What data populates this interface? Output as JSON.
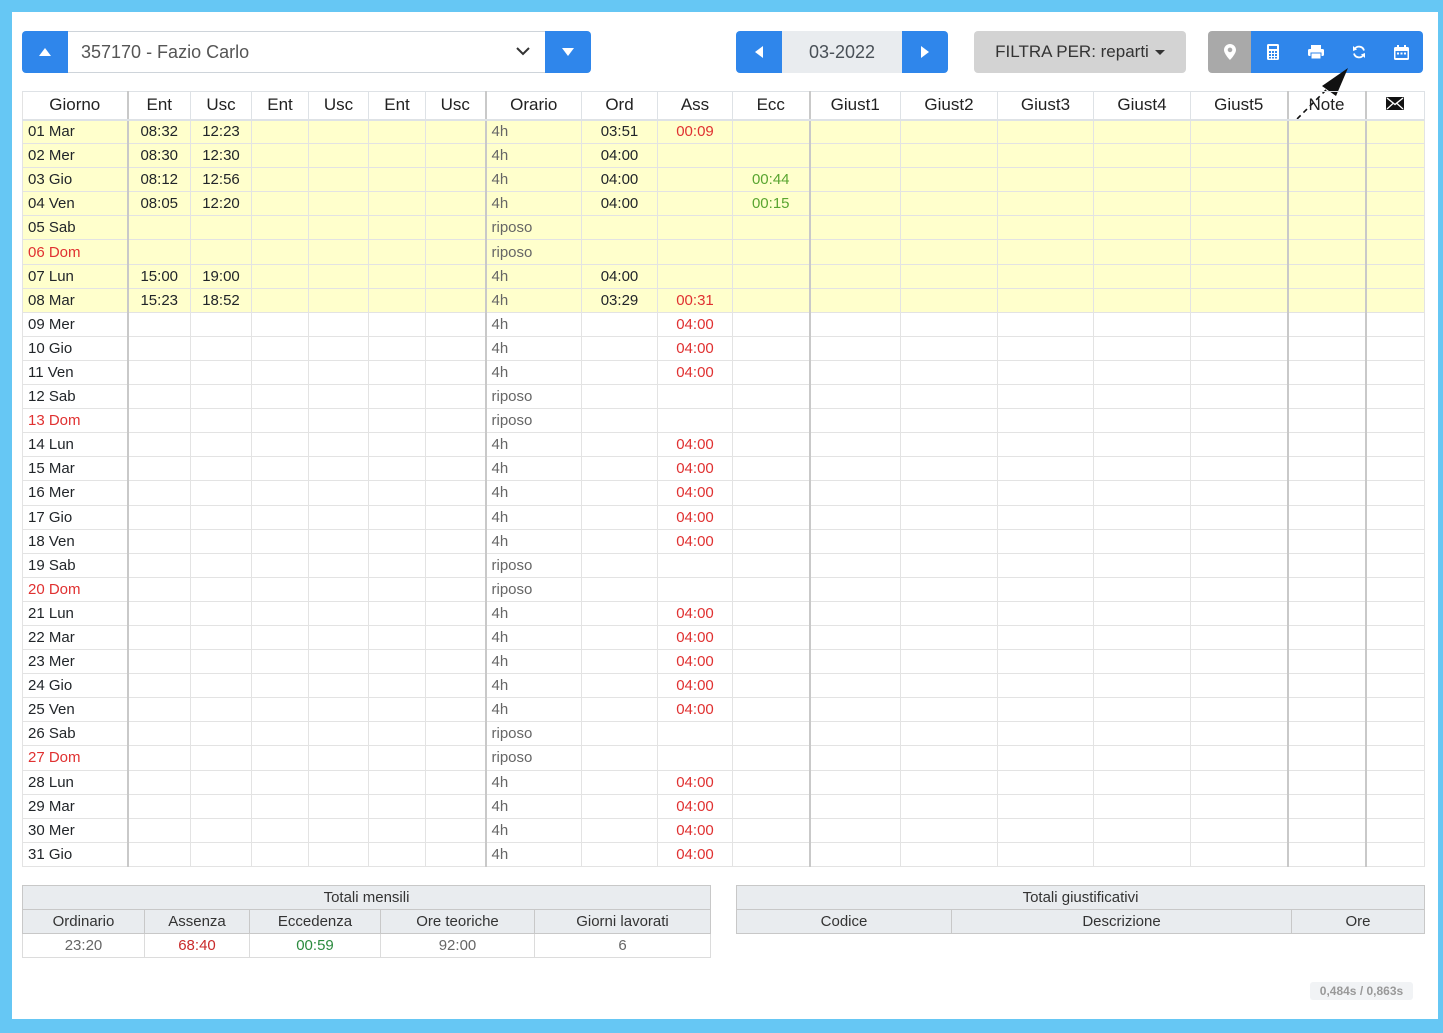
{
  "employee": {
    "selected": "357170 - Fazio Carlo"
  },
  "period": {
    "month": "03-2022"
  },
  "filter": {
    "label": "FILTRA PER: reparti"
  },
  "toolbar": {
    "icons": [
      "map-marker-icon",
      "calculator-icon",
      "print-icon",
      "refresh-icon",
      "calendar-icon"
    ]
  },
  "table": {
    "headers": [
      "Giorno",
      "Ent",
      "Usc",
      "Ent",
      "Usc",
      "Ent",
      "Usc",
      "Orario",
      "Ord",
      "Ass",
      "Ecc",
      "Giust1",
      "Giust2",
      "Giust3",
      "Giust4",
      "Giust5",
      "Note"
    ],
    "rows": [
      {
        "day": "01 Mar",
        "e1": "08:32",
        "u1": "12:23",
        "orario": "4h",
        "ord": "03:51",
        "ass": "00:09",
        "ecc": "",
        "hl": true,
        "sunday": false
      },
      {
        "day": "02 Mer",
        "e1": "08:30",
        "u1": "12:30",
        "orario": "4h",
        "ord": "04:00",
        "ass": "",
        "ecc": "",
        "hl": true,
        "sunday": false
      },
      {
        "day": "03 Gio",
        "e1": "08:12",
        "u1": "12:56",
        "orario": "4h",
        "ord": "04:00",
        "ass": "",
        "ecc": "00:44",
        "hl": true,
        "sunday": false
      },
      {
        "day": "04 Ven",
        "e1": "08:05",
        "u1": "12:20",
        "orario": "4h",
        "ord": "04:00",
        "ass": "",
        "ecc": "00:15",
        "hl": true,
        "sunday": false
      },
      {
        "day": "05 Sab",
        "e1": "",
        "u1": "",
        "orario": "riposo",
        "ord": "",
        "ass": "",
        "ecc": "",
        "hl": true,
        "sunday": false
      },
      {
        "day": "06 Dom",
        "e1": "",
        "u1": "",
        "orario": "riposo",
        "ord": "",
        "ass": "",
        "ecc": "",
        "hl": true,
        "sunday": true
      },
      {
        "day": "07 Lun",
        "e1": "15:00",
        "u1": "19:00",
        "orario": "4h",
        "ord": "04:00",
        "ass": "",
        "ecc": "",
        "hl": true,
        "sunday": false
      },
      {
        "day": "08 Mar",
        "e1": "15:23",
        "u1": "18:52",
        "orario": "4h",
        "ord": "03:29",
        "ass": "00:31",
        "ecc": "",
        "hl": true,
        "sunday": false
      },
      {
        "day": "09 Mer",
        "e1": "",
        "u1": "",
        "orario": "4h",
        "ord": "",
        "ass": "04:00",
        "ecc": "",
        "hl": false,
        "sunday": false
      },
      {
        "day": "10 Gio",
        "e1": "",
        "u1": "",
        "orario": "4h",
        "ord": "",
        "ass": "04:00",
        "ecc": "",
        "hl": false,
        "sunday": false
      },
      {
        "day": "11 Ven",
        "e1": "",
        "u1": "",
        "orario": "4h",
        "ord": "",
        "ass": "04:00",
        "ecc": "",
        "hl": false,
        "sunday": false
      },
      {
        "day": "12 Sab",
        "e1": "",
        "u1": "",
        "orario": "riposo",
        "ord": "",
        "ass": "",
        "ecc": "",
        "hl": false,
        "sunday": false
      },
      {
        "day": "13 Dom",
        "e1": "",
        "u1": "",
        "orario": "riposo",
        "ord": "",
        "ass": "",
        "ecc": "",
        "hl": false,
        "sunday": true
      },
      {
        "day": "14 Lun",
        "e1": "",
        "u1": "",
        "orario": "4h",
        "ord": "",
        "ass": "04:00",
        "ecc": "",
        "hl": false,
        "sunday": false
      },
      {
        "day": "15 Mar",
        "e1": "",
        "u1": "",
        "orario": "4h",
        "ord": "",
        "ass": "04:00",
        "ecc": "",
        "hl": false,
        "sunday": false
      },
      {
        "day": "16 Mer",
        "e1": "",
        "u1": "",
        "orario": "4h",
        "ord": "",
        "ass": "04:00",
        "ecc": "",
        "hl": false,
        "sunday": false
      },
      {
        "day": "17 Gio",
        "e1": "",
        "u1": "",
        "orario": "4h",
        "ord": "",
        "ass": "04:00",
        "ecc": "",
        "hl": false,
        "sunday": false
      },
      {
        "day": "18 Ven",
        "e1": "",
        "u1": "",
        "orario": "4h",
        "ord": "",
        "ass": "04:00",
        "ecc": "",
        "hl": false,
        "sunday": false
      },
      {
        "day": "19 Sab",
        "e1": "",
        "u1": "",
        "orario": "riposo",
        "ord": "",
        "ass": "",
        "ecc": "",
        "hl": false,
        "sunday": false
      },
      {
        "day": "20 Dom",
        "e1": "",
        "u1": "",
        "orario": "riposo",
        "ord": "",
        "ass": "",
        "ecc": "",
        "hl": false,
        "sunday": true
      },
      {
        "day": "21 Lun",
        "e1": "",
        "u1": "",
        "orario": "4h",
        "ord": "",
        "ass": "04:00",
        "ecc": "",
        "hl": false,
        "sunday": false
      },
      {
        "day": "22 Mar",
        "e1": "",
        "u1": "",
        "orario": "4h",
        "ord": "",
        "ass": "04:00",
        "ecc": "",
        "hl": false,
        "sunday": false
      },
      {
        "day": "23 Mer",
        "e1": "",
        "u1": "",
        "orario": "4h",
        "ord": "",
        "ass": "04:00",
        "ecc": "",
        "hl": false,
        "sunday": false
      },
      {
        "day": "24 Gio",
        "e1": "",
        "u1": "",
        "orario": "4h",
        "ord": "",
        "ass": "04:00",
        "ecc": "",
        "hl": false,
        "sunday": false
      },
      {
        "day": "25 Ven",
        "e1": "",
        "u1": "",
        "orario": "4h",
        "ord": "",
        "ass": "04:00",
        "ecc": "",
        "hl": false,
        "sunday": false
      },
      {
        "day": "26 Sab",
        "e1": "",
        "u1": "",
        "orario": "riposo",
        "ord": "",
        "ass": "",
        "ecc": "",
        "hl": false,
        "sunday": false
      },
      {
        "day": "27 Dom",
        "e1": "",
        "u1": "",
        "orario": "riposo",
        "ord": "",
        "ass": "",
        "ecc": "",
        "hl": false,
        "sunday": true
      },
      {
        "day": "28 Lun",
        "e1": "",
        "u1": "",
        "orario": "4h",
        "ord": "",
        "ass": "04:00",
        "ecc": "",
        "hl": false,
        "sunday": false
      },
      {
        "day": "29 Mar",
        "e1": "",
        "u1": "",
        "orario": "4h",
        "ord": "",
        "ass": "04:00",
        "ecc": "",
        "hl": false,
        "sunday": false
      },
      {
        "day": "30 Mer",
        "e1": "",
        "u1": "",
        "orario": "4h",
        "ord": "",
        "ass": "04:00",
        "ecc": "",
        "hl": false,
        "sunday": false
      },
      {
        "day": "31 Gio",
        "e1": "",
        "u1": "",
        "orario": "4h",
        "ord": "",
        "ass": "04:00",
        "ecc": "",
        "hl": false,
        "sunday": false
      }
    ]
  },
  "totali_mensili": {
    "title": "Totali mensili",
    "headers": [
      "Ordinario",
      "Assenza",
      "Eccedenza",
      "Ore teoriche",
      "Giorni lavorati"
    ],
    "values": [
      "23:20",
      "68:40",
      "00:59",
      "92:00",
      "6"
    ]
  },
  "totali_giustificativi": {
    "title": "Totali giustificativi",
    "headers": [
      "Codice",
      "Descrizione",
      "Ore"
    ]
  },
  "timing": "0,484s / 0,863s",
  "colors": {
    "accent": "#2f86eb",
    "highlight_row": "#ffffcc",
    "absence": "#e03131",
    "excess": "#5aa530",
    "frame": "#66c7f4"
  }
}
